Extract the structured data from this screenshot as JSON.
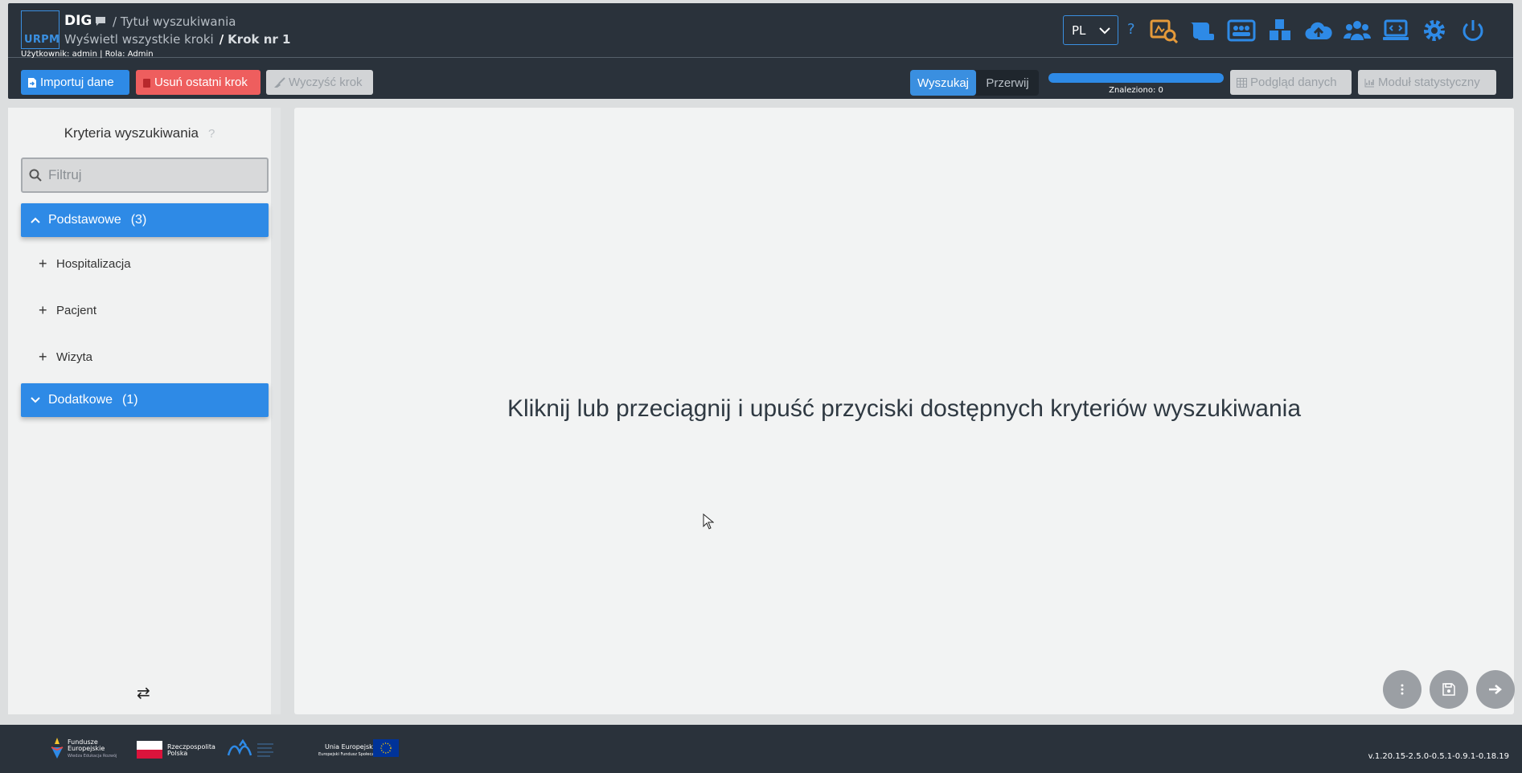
{
  "header": {
    "logo_text": "URPM",
    "app_name": "DIG",
    "search_title": "/ Tytuł wyszukiwania",
    "show_all_steps": "Wyświetl wszystkie kroki",
    "separator": "/",
    "current_step": "Krok nr 1",
    "user_info": "Użytkownik: admin | Rola: Admin",
    "language": "PL",
    "help": "?",
    "icons": [
      "search-results-icon",
      "records-icon",
      "patients-icon",
      "modules-icon",
      "cloud-upload-icon",
      "users-icon",
      "console-icon",
      "settings-icon",
      "power-icon"
    ]
  },
  "toolbar": {
    "import_label": "Importuj dane",
    "remove_last_label": "Usuń ostatni krok",
    "clear_step_label": "Wyczyść krok",
    "search_label": "Wyszukaj",
    "stop_label": "Przerwij",
    "progress": 1.0,
    "found_label": "Znaleziono: 0",
    "preview_label": "Podgląd danych",
    "stats_label": "Moduł statystyczny"
  },
  "sidebar": {
    "title": "Kryteria wyszukiwania",
    "help": "?",
    "filter_placeholder": "Filtruj",
    "groups": [
      {
        "label": "Podstawowe",
        "count": "(3)",
        "expanded": true,
        "items": [
          "Hospitalizacja",
          "Pacjent",
          "Wizyta"
        ]
      },
      {
        "label": "Dodatkowe",
        "count": "(1)",
        "expanded": false,
        "items": []
      }
    ],
    "swap_symbol": "⇄"
  },
  "main": {
    "placeholder": "Kliknij lub przeciągnij i upuść przyciski dostępnych kryteriów wyszukiwania"
  },
  "footer": {
    "logos": [
      {
        "line1": "Fundusze",
        "line2": "Europejskie",
        "line3": "Wiedza Edukacja Rozwój"
      },
      {
        "line1": "Rzeczpospolita",
        "line2": "Polska"
      },
      {
        "line1": "Unia Europejska",
        "line2": "Europejski Fundusz Społeczny"
      }
    ],
    "version": "v.1.20.15-2.5.0-0.5.1-0.9.1-0.18.19"
  },
  "colors": {
    "header_bg": "#2a323b",
    "accent": "#2e8ae6",
    "danger": "#ee5e5e",
    "icon_orange": "#e59a3a"
  }
}
